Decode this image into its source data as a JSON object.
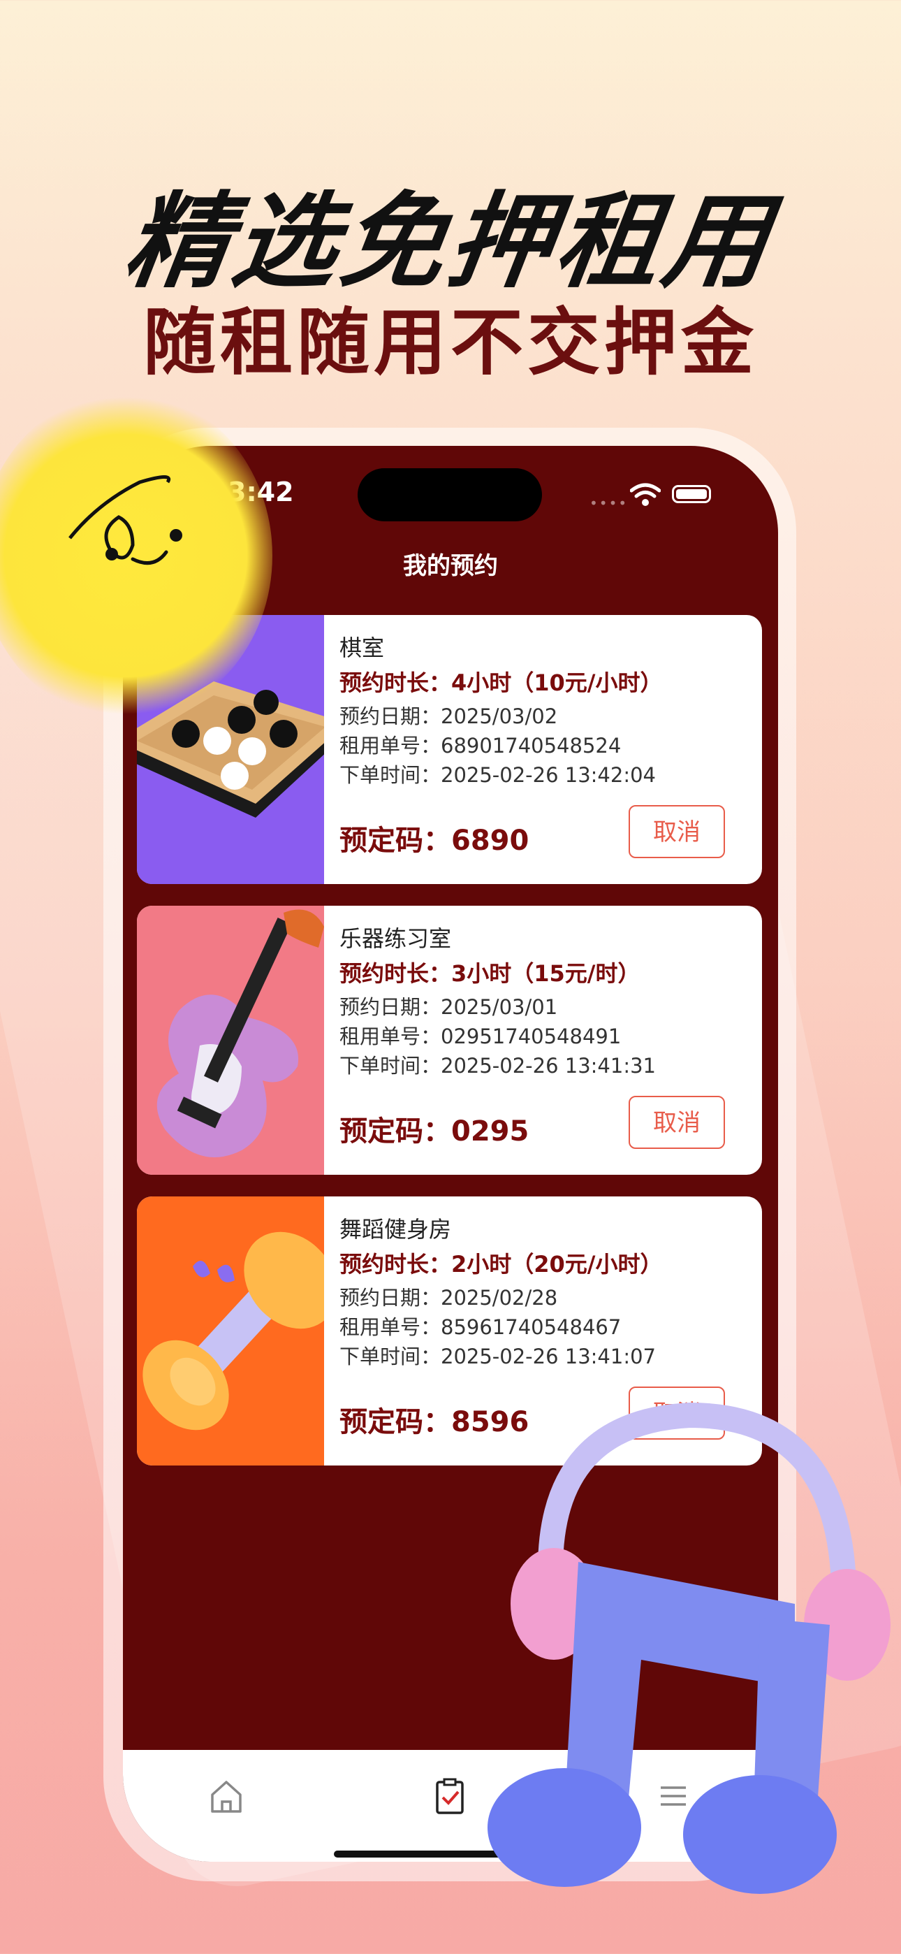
{
  "hero": {
    "title": "精选免押租用",
    "subtitle": "随租随用不交押金"
  },
  "status": {
    "time": "3:42"
  },
  "nav": {
    "title": "我的预约"
  },
  "cards": [
    {
      "title": "棋室",
      "duration": "预约时长：4小时（10元/小时）",
      "date": "预约日期：2025/03/02",
      "order": "租用单号：68901740548524",
      "created": "下单时间：2025-02-26 13:42:04",
      "code": "预定码：6890",
      "cancel": "取消",
      "thumb_color": "#8a5cf0"
    },
    {
      "title": "乐器练习室",
      "duration": "预约时长：3小时（15元/时）",
      "date": "预约日期：2025/03/01",
      "order": "租用单号：02951740548491",
      "created": "下单时间：2025-02-26 13:41:31",
      "code": "预定码：0295",
      "cancel": "取消",
      "thumb_color": "#f27a86"
    },
    {
      "title": "舞蹈健身房",
      "duration": "预约时长：2小时（20元/小时）",
      "date": "预约日期：2025/02/28",
      "order": "租用单号：85961740548467",
      "created": "下单时间：2025-02-26 13:41:07",
      "code": "预定码：8596",
      "cancel": "取消",
      "thumb_color": "#ff6a1f"
    }
  ],
  "tabs": [
    {
      "icon": "home-icon"
    },
    {
      "icon": "clipboard-check-icon"
    },
    {
      "icon": "menu-icon"
    }
  ],
  "colors": {
    "accent": "#600707",
    "cancel": "#e85c4a",
    "sun": "#fde53c"
  }
}
